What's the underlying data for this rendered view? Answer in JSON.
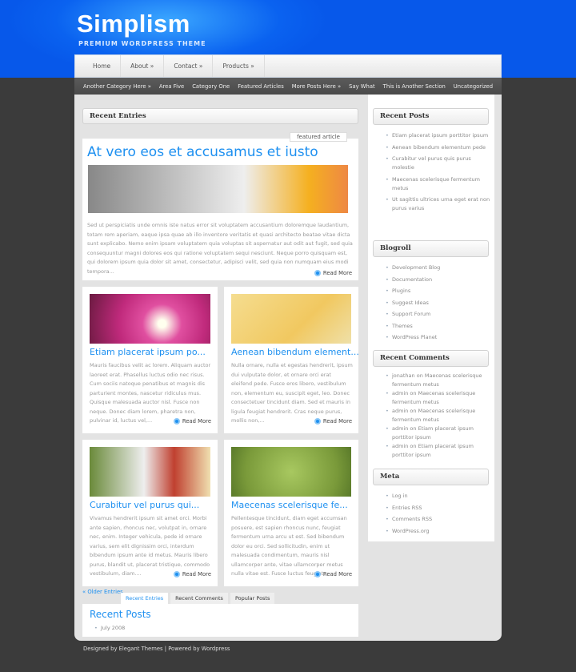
{
  "header": {
    "logo": "Simplism",
    "tagline": "PREMIUM WORDPRESS THEME"
  },
  "nav": [
    "Home",
    "About »",
    "Contact »",
    "Products »"
  ],
  "categories": [
    "Another Category Here »",
    "Area Five",
    "Category One",
    "Featured Articles",
    "More Posts Here »",
    "Say What",
    "This is Another Section",
    "Uncategorized"
  ],
  "main": {
    "section_title": "Recent Entries",
    "featured": {
      "badge": "featured article",
      "title": "At vero eos et accusamus et iusto",
      "excerpt": "Sed ut perspiciatis unde omnis iste natus error sit voluptatem accusantium doloremque laudantium, totam rem aperiam, eaque ipsa quae ab illo inventore veritatis et quasi architecto beatae vitae dicta sunt explicabo. Nemo enim ipsam voluptatem quia voluptas sit aspernatur aut odit aut fugit, sed quia consequuntur magni dolores eos qui ratione voluptatem sequi nesciunt. Neque porro quisquam est, qui dolorem ipsum quia dolor sit amet, consectetur, adipisci velit, sed quia non numquam eius modi tempora...",
      "read_more": "Read More"
    },
    "posts": [
      {
        "title": "Etiam placerat ipsum po...",
        "excerpt": "Mauris faucibus velit ac lorem. Aliquam auctor laoreet erat. Phasellus luctus odio nec risus. Cum sociis natoque penatibus et magnis dis parturient montes, nascetur ridiculus mus. Quisque malesuada auctor nisl. Fusce non neque. Donec diam lorem, pharetra non, pulvinar id, luctus vel,...",
        "read_more": "Read More"
      },
      {
        "title": "Aenean bibendum element...",
        "excerpt": "Nulla ornare, nulla et egestas hendrerit, ipsum dui vulputate dolor, et ornare orci erat eleifend pede. Fusce eros libero, vestibulum non, elementum eu, suscipit eget, leo. Donec consectetuer tincidunt diam. Sed et mauris in ligula feugiat hendrerit. Cras neque purus, mollis non,...",
        "read_more": "Read More"
      },
      {
        "title": "Curabitur vel purus qui...",
        "excerpt": "Vivamus hendrerit ipsum sit amet orci. Morbi ante sapien, rhoncus nec, volutpat in, ornare nec, enim. Integer vehicula, pede id ornare varius, sem elit dignissim orci, interdum bibendum ipsum ante id metus. Mauris libero purus, blandit ut, placerat tristique, commodo vestibulum, diam....",
        "read_more": "Read More"
      },
      {
        "title": "Maecenas scelerisque fe...",
        "excerpt": "Pellentesque tincidunt, diam eget accumsan posuere, est sapien rhoncus nunc, feugiat fermentum urna arcu ut est. Sed bibendum dolor eu orci. Sed sollicitudin, enim ut malesuada condimentum, mauris nisl ullamcorper ante, vitae ullamcorper metus nulla vitae est. Fusce luctus feugiat...",
        "read_more": "Read More"
      }
    ],
    "older": "« Older Entries",
    "tabs": [
      "Recent Entries",
      "Recent Comments",
      "Popular Posts"
    ],
    "tab_panel": {
      "title": "Recent Posts",
      "items": [
        "July 2008"
      ]
    }
  },
  "sidebar": {
    "recent_posts": {
      "title": "Recent Posts",
      "items": [
        "Etiam placerat ipsum porttitor ipsum",
        "Aenean bibendum elementum pede",
        "Curabitur vel purus quis purus molestie",
        "Maecenas scelerisque fermentum metus",
        "Ut sagittis ultrices urna eget erat non purus varius"
      ]
    },
    "blogroll": {
      "title": "Blogroll",
      "items": [
        "Development Blog",
        "Documentation",
        "Plugins",
        "Suggest Ideas",
        "Support Forum",
        "Themes",
        "WordPress Planet"
      ]
    },
    "recent_comments": {
      "title": "Recent Comments",
      "items": [
        "jonathan on Maecenas scelerisque fermentum metus",
        "admin on Maecenas scelerisque fermentum metus",
        "admin on Maecenas scelerisque fermentum metus",
        "admin on Etiam placerat ipsum porttitor ipsum",
        "admin on Etiam placerat ipsum porttitor ipsum"
      ]
    },
    "meta": {
      "title": "Meta",
      "items": [
        "Log in",
        "Entries RSS",
        "Comments RSS",
        "WordPress.org"
      ]
    }
  },
  "footer": "Designed by Elegant Themes | Powered by Wordpress",
  "colors": {
    "accent": "#1e90f0",
    "header_blue": "#0a62f0"
  }
}
